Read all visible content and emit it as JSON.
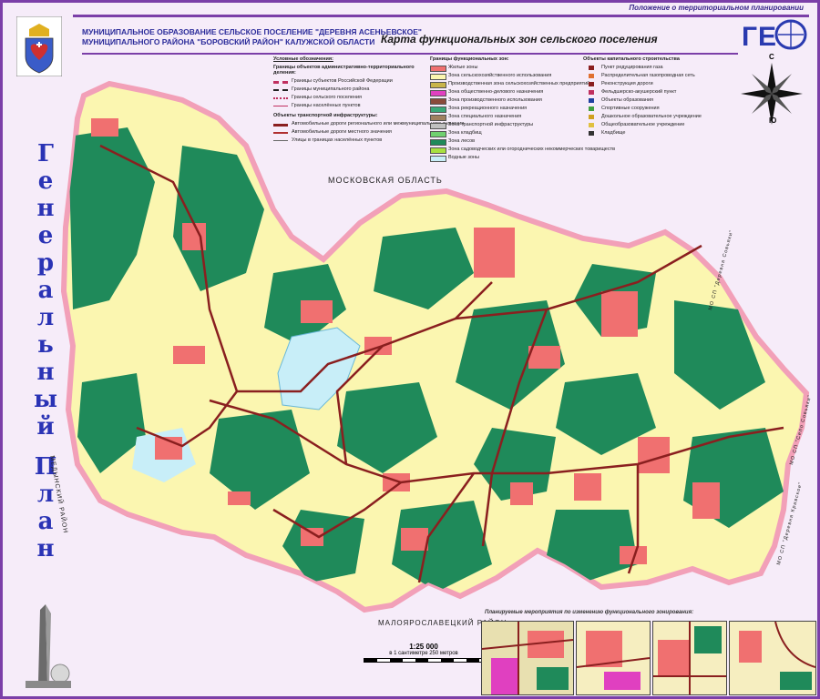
{
  "top_caption": "Положение о территориальном планировании",
  "header": {
    "line1": "МУНИЦИПАЛЬНОЕ ОБРАЗОВАНИЕ СЕЛЬСКОЕ ПОСЕЛЕНИЕ \"ДЕРЕВНЯ АСЕНЬЕВСКОЕ\"",
    "line2": "МУНИЦИПАЛЬНОГО РАЙОНА \"БОРОВСКИЙ РАЙОН\" КАЛУЖСКОЙ ОБЛАСТИ"
  },
  "map_title": "Карта функциональных зон сельского поселения",
  "vertical_title_letters": [
    "Г",
    "е",
    "н",
    "е",
    "р",
    "а",
    "л",
    "ь",
    "н",
    "ы",
    "й"
  ],
  "vertical_title2_letters": [
    "П",
    "л",
    "а",
    "н"
  ],
  "legend": {
    "title": "Условные обозначения:",
    "boundaries_title": "Границы объектов административно-территориального деления:",
    "boundaries": [
      "Границы субъектов Российской Федерации",
      "Границы муниципального района",
      "Границы сельского поселения",
      "Границы населённых пунктов"
    ],
    "transport_title": "Объекты транспортной инфраструктуры:",
    "transport": [
      "Автомобильные дороги регионального или межмуниципального значения",
      "Автомобильные дороги местного значения",
      "Улицы в границах населённых пунктов"
    ],
    "zones_title": "Границы функциональных зон:",
    "zones": [
      {
        "label": "Жилые зоны",
        "color": "#f07070"
      },
      {
        "label": "Зона сельскохозяйственного использования",
        "color": "#fbf6b0"
      },
      {
        "label": "Производственная зона сельскохозяйственных предприятий",
        "color": "#c8b44a"
      },
      {
        "label": "Зона общественно-делового назначения",
        "color": "#e040c0"
      },
      {
        "label": "Зона производственного использования",
        "color": "#8a4a3a"
      },
      {
        "label": "Зона рекреационного назначения",
        "color": "#3aa878"
      },
      {
        "label": "Зона специального назначения",
        "color": "#a08060"
      },
      {
        "label": "Зона транспортной инфраструктуры",
        "color": "#c0c0c0"
      },
      {
        "label": "Зона кладбищ",
        "color": "#70d070"
      },
      {
        "label": "Зона лесов",
        "color": "#1f8a5a"
      },
      {
        "label": "Зона садоводческих или огороднических некоммерческих товариществ",
        "color": "#a8e040"
      },
      {
        "label": "Водные зоны",
        "color": "#c8eef8"
      }
    ],
    "objects_title": "Объекты капитального строительства",
    "objects": [
      "Пункт редуцирования газа",
      "Распределительная газопроводная сеть",
      "Реконструкция дороги",
      "Фельдшерско-акушерский пункт",
      "Объекты образования",
      "Спортивные сооружения",
      "Дошкольное образовательное учреждение",
      "Общеобразовательное учреждение",
      "Кладбище"
    ]
  },
  "labels": {
    "moscow_region": "МОСКОВСКАЯ ОБЛАСТЬ",
    "maloyaroslavets": "МАЛОЯРОСЛАВЕЦКИЙ РАЙОН",
    "medyn": "МЕДЫНСКИЙ РАЙОН",
    "snt_right1": "МО СП \"Деревня Совьяки\"",
    "snt_right2": "МО СП \"Село Совьяки\"",
    "snt_right3": "МО СП \"Деревня Кривское\""
  },
  "compass": {
    "north": "С",
    "south": "Ю"
  },
  "scale": {
    "value": "1:25 000",
    "sub": "в 1 сантиметре 250 метров"
  },
  "insets_caption": "Планируемые мероприятия по изменению функционального зонирования:",
  "colors": {
    "frame": "#7b3fa8",
    "title_blue": "#2a33b5",
    "forest": "#1f8a5a",
    "agri": "#fbf6b0",
    "residential": "#f07070",
    "boundary": "#f2a0b8"
  }
}
